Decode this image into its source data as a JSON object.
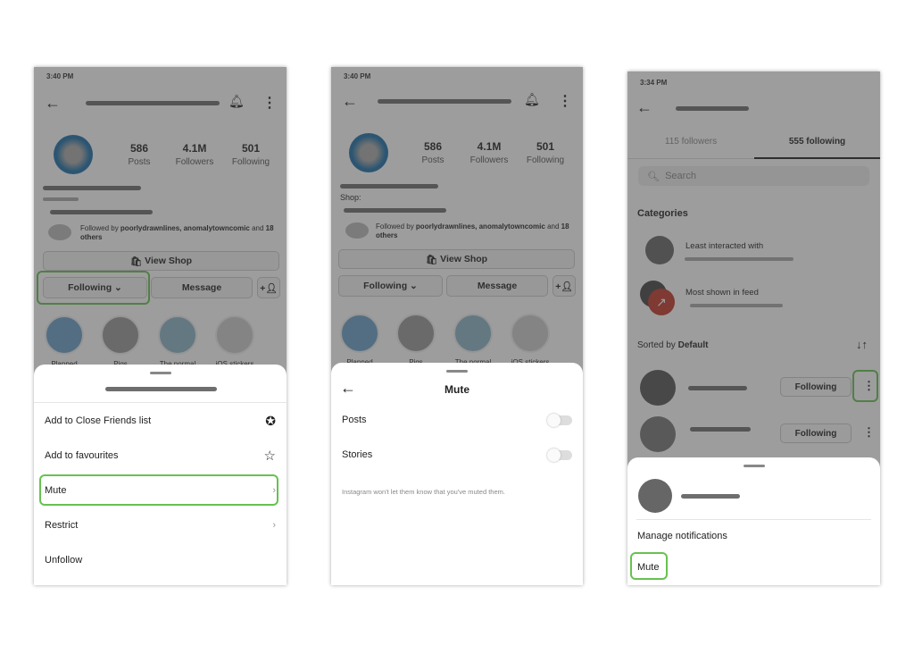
{
  "colors": {
    "highlight": "#66c250",
    "overlay": "rgba(60,60,60,0.5)"
  },
  "profile": {
    "posts": "586",
    "posts_label": "Posts",
    "followers": "4.1M",
    "followers_label": "Followers",
    "following": "501",
    "following_label": "Following",
    "shop_text": "Shop:",
    "followed_by_prefix": "Followed by ",
    "followed_by_names": "poorlydrawnlines, anomalytowncomic",
    "followed_by_and": " and ",
    "followed_by_others": "18 others",
    "view_shop": "View Shop",
    "following_btn": "Following",
    "message_btn": "Message",
    "highlights": [
      "Planned",
      "Pigs",
      "The normal",
      "iOS stickers"
    ]
  },
  "panel1": {
    "time": "3:40 PM",
    "menu": [
      {
        "label": "Add to Close Friends list",
        "icon": "close-friends-star-circle-icon"
      },
      {
        "label": "Add to favourites",
        "icon": "star-outline-icon"
      },
      {
        "label": "Mute",
        "icon": "chevron-right-icon"
      },
      {
        "label": "Restrict",
        "icon": "chevron-right-icon"
      },
      {
        "label": "Unfollow",
        "icon": ""
      }
    ]
  },
  "panel2": {
    "time": "3:40 PM",
    "title": "Mute",
    "options": [
      {
        "label": "Posts",
        "on": false
      },
      {
        "label": "Stories",
        "on": false
      }
    ],
    "note": "Instagram won't let them know that you've muted them."
  },
  "panel3": {
    "time": "3:34 PM",
    "tabs": [
      "115 followers",
      "555 following"
    ],
    "search_placeholder": "Search",
    "categories_title": "Categories",
    "categories": [
      "Least interacted with",
      "Most shown in feed"
    ],
    "sorted_prefix": "Sorted by ",
    "sorted_value": "Default",
    "following_btn": "Following",
    "sheet": {
      "manage": "Manage notifications",
      "mute": "Mute"
    }
  }
}
